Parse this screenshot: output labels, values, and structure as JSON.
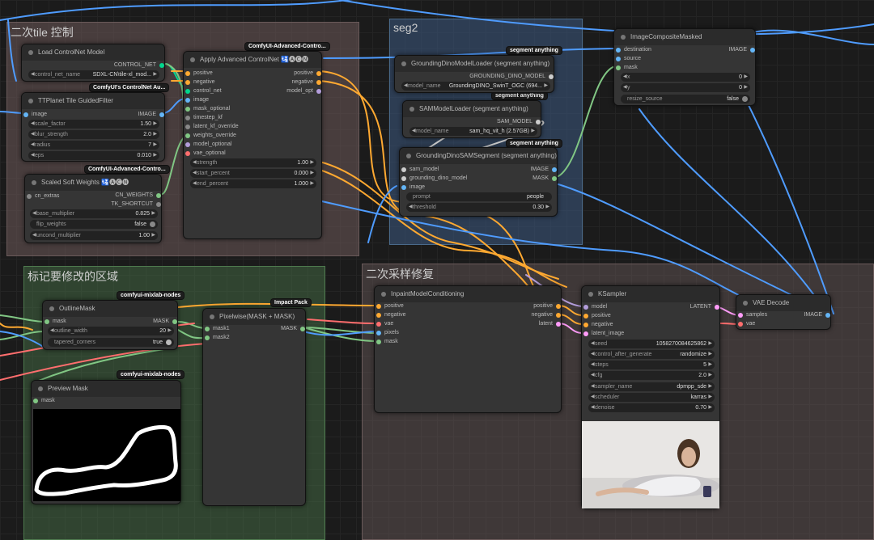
{
  "groups": {
    "tile_control": "二次tile 控制",
    "seg2": "seg2",
    "mark_region": "标记要修改的区域",
    "resample": "二次采样修复"
  },
  "colors": {
    "model": "#b39ddb",
    "conditioning": "#ffa931",
    "image": "#64b5f6",
    "mask": "#81c784",
    "latent": "#ff9cf9",
    "vae": "#ff6e6e",
    "control_net": "#00d78d",
    "blue_wire": "#4f9cff"
  },
  "badges": {
    "comfyui_adv_1": "ComfyUI-Advanced-Contro...",
    "comfyui_controlnet_aux": "ComfyUI's ControlNet Au...",
    "comfyui_adv_2": "ComfyUI-Advanced-Contro...",
    "segment_anything_1": "segment anything",
    "segment_anything_2": "segment anything",
    "segment_anything_3": "segment anything",
    "mixlab_1": "comfyui-mixlab-nodes",
    "mixlab_2": "comfyui-mixlab-nodes",
    "impact_pack": "Impact Pack"
  },
  "nodes": {
    "load_controlnet": {
      "title": "Load ControlNet Model",
      "out_control_net": "CONTROL_NET",
      "control_net_name_label": "control_net_name",
      "control_net_name_value": "SDXL-CN\\tile-xl_mod..."
    },
    "apply_adv_controlnet": {
      "title": "Apply Advanced ControlNet 🛂🅐🅒🅝",
      "in_positive": "positive",
      "in_negative": "negative",
      "in_control_net": "control_net",
      "in_image": "image",
      "in_mask_optional": "mask_optional",
      "in_timestep_kf": "timestep_kf",
      "in_latent_kf_override": "latent_kf_override",
      "in_weights_override": "weights_override",
      "in_model_optional": "model_optional",
      "in_vae_optional": "vae_optional",
      "out_positive": "positive",
      "out_negative": "negative",
      "out_model_opt": "model_opt",
      "w_strength_label": "strength",
      "w_strength_value": "1.00",
      "w_start_label": "start_percent",
      "w_start_value": "0.000",
      "w_end_label": "end_percent",
      "w_end_value": "1.000"
    },
    "ttplanet": {
      "title": "TTPlanet Tile GuidedFilter",
      "in_image": "image",
      "out_image": "IMAGE",
      "w_scale_label": "scale_factor",
      "w_scale_value": "1.50",
      "w_blur_label": "blur_strength",
      "w_blur_value": "2.0",
      "w_radius_label": "radius",
      "w_radius_value": "7",
      "w_eps_label": "eps",
      "w_eps_value": "0.010"
    },
    "scaled_soft": {
      "title": "Scaled Soft Weights 🛂🅐🅒🅝",
      "in_cn_extras": "cn_extras",
      "out_cn_weights": "CN_WEIGHTS",
      "out_tk_shortcut": "TK_SHORTCUT",
      "w_base_label": "base_multiplier",
      "w_base_value": "0.825",
      "w_flip_label": "flip_weights",
      "w_flip_value": "false",
      "w_uncond_label": "uncond_multiplier",
      "w_uncond_value": "1.00"
    },
    "gdino_loader": {
      "title": "GroundingDinoModelLoader (segment anything)",
      "out": "GROUNDING_DINO_MODEL",
      "w_label": "model_name",
      "w_value": "GroundingDINO_SwinT_OGC (694..."
    },
    "sam_loader": {
      "title": "SAMModelLoader (segment anything)",
      "out": "SAM_MODEL",
      "w_label": "model_name",
      "w_value": "sam_hq_vit_h (2.57GB)"
    },
    "gdino_sam": {
      "title": "GroundingDinoSAMSegment (segment anything)",
      "in_sam_model": "sam_model",
      "in_gdino": "grounding_dino_model",
      "in_image": "image",
      "out_image": "IMAGE",
      "out_mask": "MASK",
      "w_prompt_label": "prompt",
      "w_prompt_value": "people",
      "w_threshold_label": "threshold",
      "w_threshold_value": "0.30"
    },
    "image_composite": {
      "title": "ImageCompositeMasked",
      "in_destination": "destination",
      "in_source": "source",
      "in_mask": "mask",
      "out_image": "IMAGE",
      "w_x_label": "x",
      "w_x_value": "0",
      "w_y_label": "y",
      "w_y_value": "0",
      "w_resize_label": "resize_source",
      "w_resize_value": "false"
    },
    "outline_mask": {
      "title": "OutlineMask",
      "in_mask": "mask",
      "out_mask": "MASK",
      "w_width_label": "outline_width",
      "w_width_value": "20",
      "w_tapered_label": "tapered_corners",
      "w_tapered_value": "true"
    },
    "pixelwise": {
      "title": "Pixelwise(MASK + MASK)",
      "in_mask1": "mask1",
      "in_mask2": "mask2",
      "out_mask": "MASK"
    },
    "preview_mask": {
      "title": "Preview Mask",
      "in_mask": "mask"
    },
    "inpaint_cond": {
      "title": "InpaintModelConditioning",
      "in_positive": "positive",
      "in_negative": "negative",
      "in_vae": "vae",
      "in_pixels": "pixels",
      "in_mask": "mask",
      "out_positive": "positive",
      "out_negative": "negative",
      "out_latent": "latent"
    },
    "ksampler": {
      "title": "KSampler",
      "in_model": "model",
      "in_positive": "positive",
      "in_negative": "negative",
      "in_latent": "latent_image",
      "out_latent": "LATENT",
      "w_seed_label": "seed",
      "w_seed_value": "1058270084625862",
      "w_control_label": "control_after_generate",
      "w_control_value": "randomize",
      "w_steps_label": "steps",
      "w_steps_value": "5",
      "w_cfg_label": "cfg",
      "w_cfg_value": "2.0",
      "w_sampler_label": "sampler_name",
      "w_sampler_value": "dpmpp_sde",
      "w_scheduler_label": "scheduler",
      "w_scheduler_value": "karras",
      "w_denoise_label": "denoise",
      "w_denoise_value": "0.70"
    },
    "vae_decode": {
      "title": "VAE Decode",
      "in_samples": "samples",
      "in_vae": "vae",
      "out_image": "IMAGE"
    }
  }
}
